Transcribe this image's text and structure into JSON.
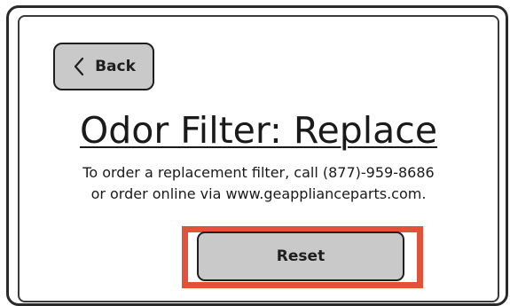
{
  "screen": {
    "title": "Odor Filter: Replace",
    "body_line_1": "To order a replacement filter, call (877)-959-8686",
    "body_line_2": "or order online via www.geapplianceparts.com."
  },
  "back_button": {
    "label": "Back",
    "icon": "chevron-left-icon"
  },
  "reset_button": {
    "label": "Reset",
    "highlighted": true
  },
  "colors": {
    "button_fill": "#c9c9c9",
    "highlight": "#e0533a",
    "ink": "#1e1e1e"
  }
}
